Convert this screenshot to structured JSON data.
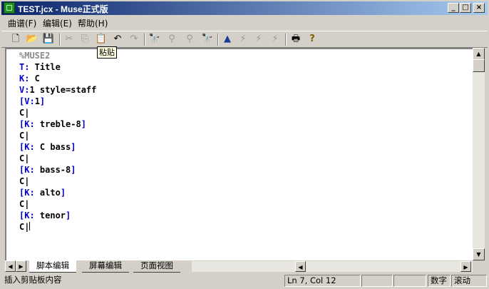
{
  "window": {
    "title": "TEST.jcx - Muse正式版"
  },
  "titlebar_buttons": {
    "minimize": "_",
    "maximize": "□",
    "close": "×"
  },
  "menu": [
    {
      "label": "曲谱(F)"
    },
    {
      "label": "编辑(E)"
    },
    {
      "label": "帮助(H)"
    }
  ],
  "toolbar": {
    "tooltip": "粘贴",
    "icons": {
      "new": "🗋",
      "open": "📂",
      "save": "💾",
      "cut": "✂",
      "copy": "⎘",
      "paste": "📋",
      "undo": "↶",
      "redo": "↷",
      "find": "🔭",
      "find_next": "⚲",
      "replace": "⚲",
      "find_red": "🔭",
      "play": "▲",
      "play_voice": "⚡",
      "play_all": "⚡",
      "stop": "⚡",
      "print": "🖶",
      "help": "?"
    }
  },
  "editor": {
    "lines": [
      {
        "parts": [
          {
            "t": "%MUSE2",
            "c": "grey"
          }
        ]
      },
      {
        "parts": [
          {
            "t": "T:",
            "c": "blue"
          },
          {
            "t": " Title",
            "c": "black"
          }
        ]
      },
      {
        "parts": [
          {
            "t": "K:",
            "c": "blue"
          },
          {
            "t": " C",
            "c": "black"
          }
        ]
      },
      {
        "parts": [
          {
            "t": "V:",
            "c": "blue"
          },
          {
            "t": "1 style=staff",
            "c": "black"
          }
        ]
      },
      {
        "parts": [
          {
            "t": "[V:",
            "c": "blue"
          },
          {
            "t": "1",
            "c": "black"
          },
          {
            "t": "]",
            "c": "blue"
          }
        ]
      },
      {
        "parts": [
          {
            "t": "C|",
            "c": "black"
          }
        ]
      },
      {
        "parts": [
          {
            "t": "[K:",
            "c": "blue"
          },
          {
            "t": " treble-8",
            "c": "black"
          },
          {
            "t": "]",
            "c": "blue"
          }
        ]
      },
      {
        "parts": [
          {
            "t": "C|",
            "c": "black"
          }
        ]
      },
      {
        "parts": [
          {
            "t": "[K:",
            "c": "blue"
          },
          {
            "t": " C bass",
            "c": "black"
          },
          {
            "t": "]",
            "c": "blue"
          }
        ]
      },
      {
        "parts": [
          {
            "t": "C|",
            "c": "black"
          }
        ]
      },
      {
        "parts": [
          {
            "t": "[K:",
            "c": "blue"
          },
          {
            "t": " bass-8",
            "c": "black"
          },
          {
            "t": "]",
            "c": "blue"
          }
        ]
      },
      {
        "parts": [
          {
            "t": "C|",
            "c": "black"
          }
        ]
      },
      {
        "parts": [
          {
            "t": "[K:",
            "c": "blue"
          },
          {
            "t": " alto",
            "c": "black"
          },
          {
            "t": "]",
            "c": "blue"
          }
        ]
      },
      {
        "parts": [
          {
            "t": "C|",
            "c": "black"
          }
        ]
      },
      {
        "parts": [
          {
            "t": "[K:",
            "c": "blue"
          },
          {
            "t": " tenor",
            "c": "black"
          },
          {
            "t": "]",
            "c": "blue"
          }
        ]
      },
      {
        "parts": [
          {
            "t": "C|",
            "c": "black"
          }
        ]
      }
    ],
    "caret_line": 15
  },
  "tabs": [
    {
      "label": "脚本编辑",
      "active": true
    },
    {
      "label": "屏幕编辑",
      "active": false
    },
    {
      "label": "页面视图",
      "active": false
    }
  ],
  "status": {
    "message": "插入剪贴板内容",
    "position": "Ln 7, Col 12",
    "numlock": "数字",
    "scroll": "滚动"
  },
  "colors": {
    "keyword": "#0000cc",
    "comment": "#8a8a8a",
    "title_bar_start": "#0a246a",
    "title_bar_end": "#a6caf0"
  }
}
